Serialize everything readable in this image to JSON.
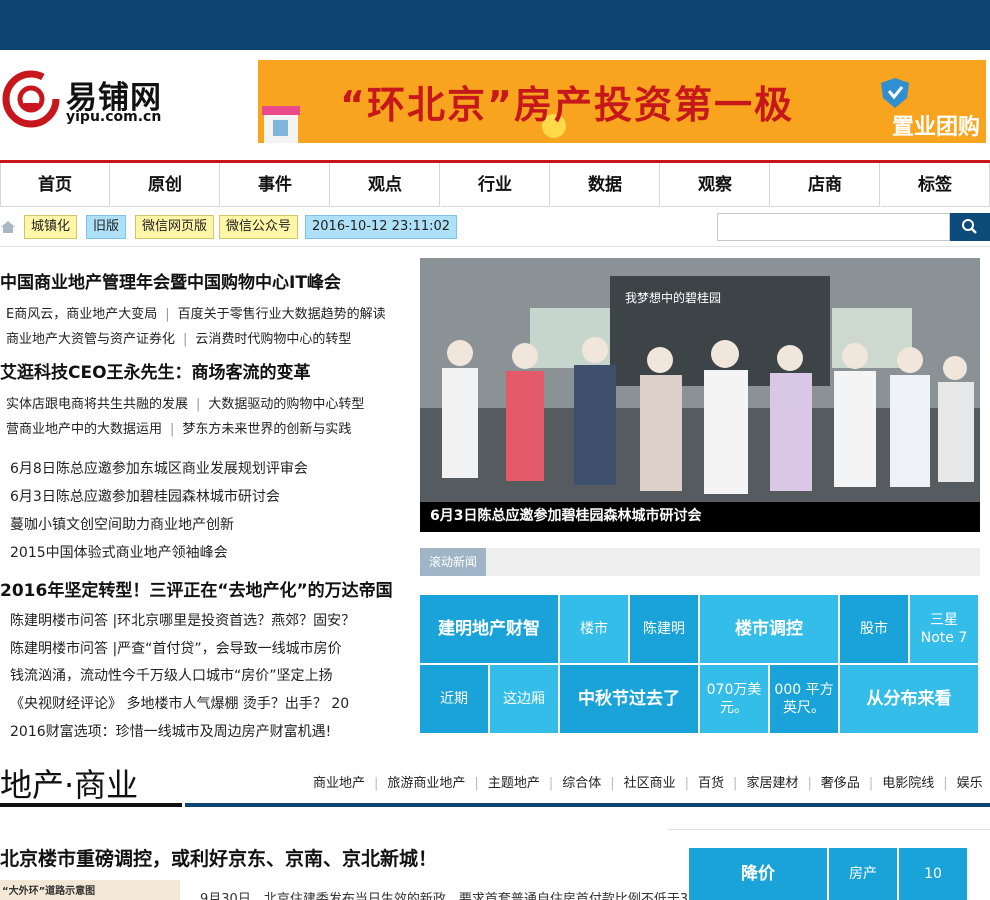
{
  "logo": {
    "cn": "易铺网",
    "en": "yipu.com.cn"
  },
  "banner": {
    "headline": "“环北京”房产投资第一极",
    "brand": "置业团购"
  },
  "nav": [
    "首页",
    "原创",
    "事件",
    "观点",
    "行业",
    "数据",
    "观察",
    "店商",
    "标签"
  ],
  "subbar": {
    "tags": [
      "城镇化",
      "旧版",
      "微信网页版",
      "微信公众号"
    ],
    "datetime": "2016-10-12 23:11:02",
    "search_placeholder": ""
  },
  "left": {
    "h1": "中国商业地产管理年会暨中国购物中心IT峰会",
    "h1_links_row1": [
      "E商风云，商业地产大变局",
      "百度关于零售行业大数据趋势的解读"
    ],
    "h1_links_row2": [
      "商业地产大资管与资产证券化",
      "云消费时代购物中心的转型"
    ],
    "h2": "艾逛科技CEO王永先生：商场客流的变革",
    "h2_links_row1": [
      "实体店跟电商将共生共融的发展",
      "大数据驱动的购物中心转型"
    ],
    "h2_links_row2": [
      "营商业地产中的大数据运用",
      "梦东方未来世界的创新与实践"
    ],
    "list1": [
      "6月8日陈总应邀参加东城区商业发展规划评审会",
      "6月3日陈总应邀参加碧桂园森林城市研讨会",
      "蔓咖小镇文创空间助力商业地产创新",
      "2015中国体验式商业地产领袖峰会"
    ],
    "h3": "2016年坚定转型！三评正在“去地产化”的万达帝国",
    "list2": [
      "陈建明楼市问答 |环北京哪里是投资首选？燕郊？固安？",
      "陈建明楼市问答 |严查“首付贷”，会导致一线城市房价",
      "钱流汹涌，流动性今千万级人口城市“房价”坚定上扬",
      "《央视财经评论》 多地楼市人气爆棚  烫手？出手？ 20",
      "2016财富选项：珍惜一线城市及周边房产财富机遇!"
    ]
  },
  "photo": {
    "board_text": "我梦想中的碧桂园",
    "caption": "6月3日陈总应邀参加碧桂园森林城市研讨会"
  },
  "roll": {
    "label": "滚动新闻"
  },
  "tiles": [
    "建明地产财智",
    "楼市",
    "陈建明",
    "楼市调控",
    "股市",
    "三星Note 7",
    "近期",
    "这边厢",
    "中秋节过去了",
    "070万美元。",
    "000 平方英尺。",
    "从分布来看"
  ],
  "section": {
    "title": "地产·商业",
    "links": [
      "商业地产",
      "旅游商业地产",
      "主题地产",
      "综合体",
      "社区商业",
      "百货",
      "家居建材",
      "奢侈品",
      "电影院线",
      "娱乐"
    ],
    "headline": "北京楼市重磅调控，或利好京东、京南、京北新城！",
    "thumb_text": "“大外环”道路示意图",
    "summary": "9月30日，北京住建委发布当日生效的新政，要求首套普通自住房首付款比例不低于3"
  },
  "bottom_tiles": [
    "降价",
    "房产",
    "10"
  ],
  "colors": {
    "topbar": "#0d4470",
    "nav_accent": "#c8171c",
    "tile_dark": "#19a3d8",
    "tile_light": "#35bdea"
  }
}
